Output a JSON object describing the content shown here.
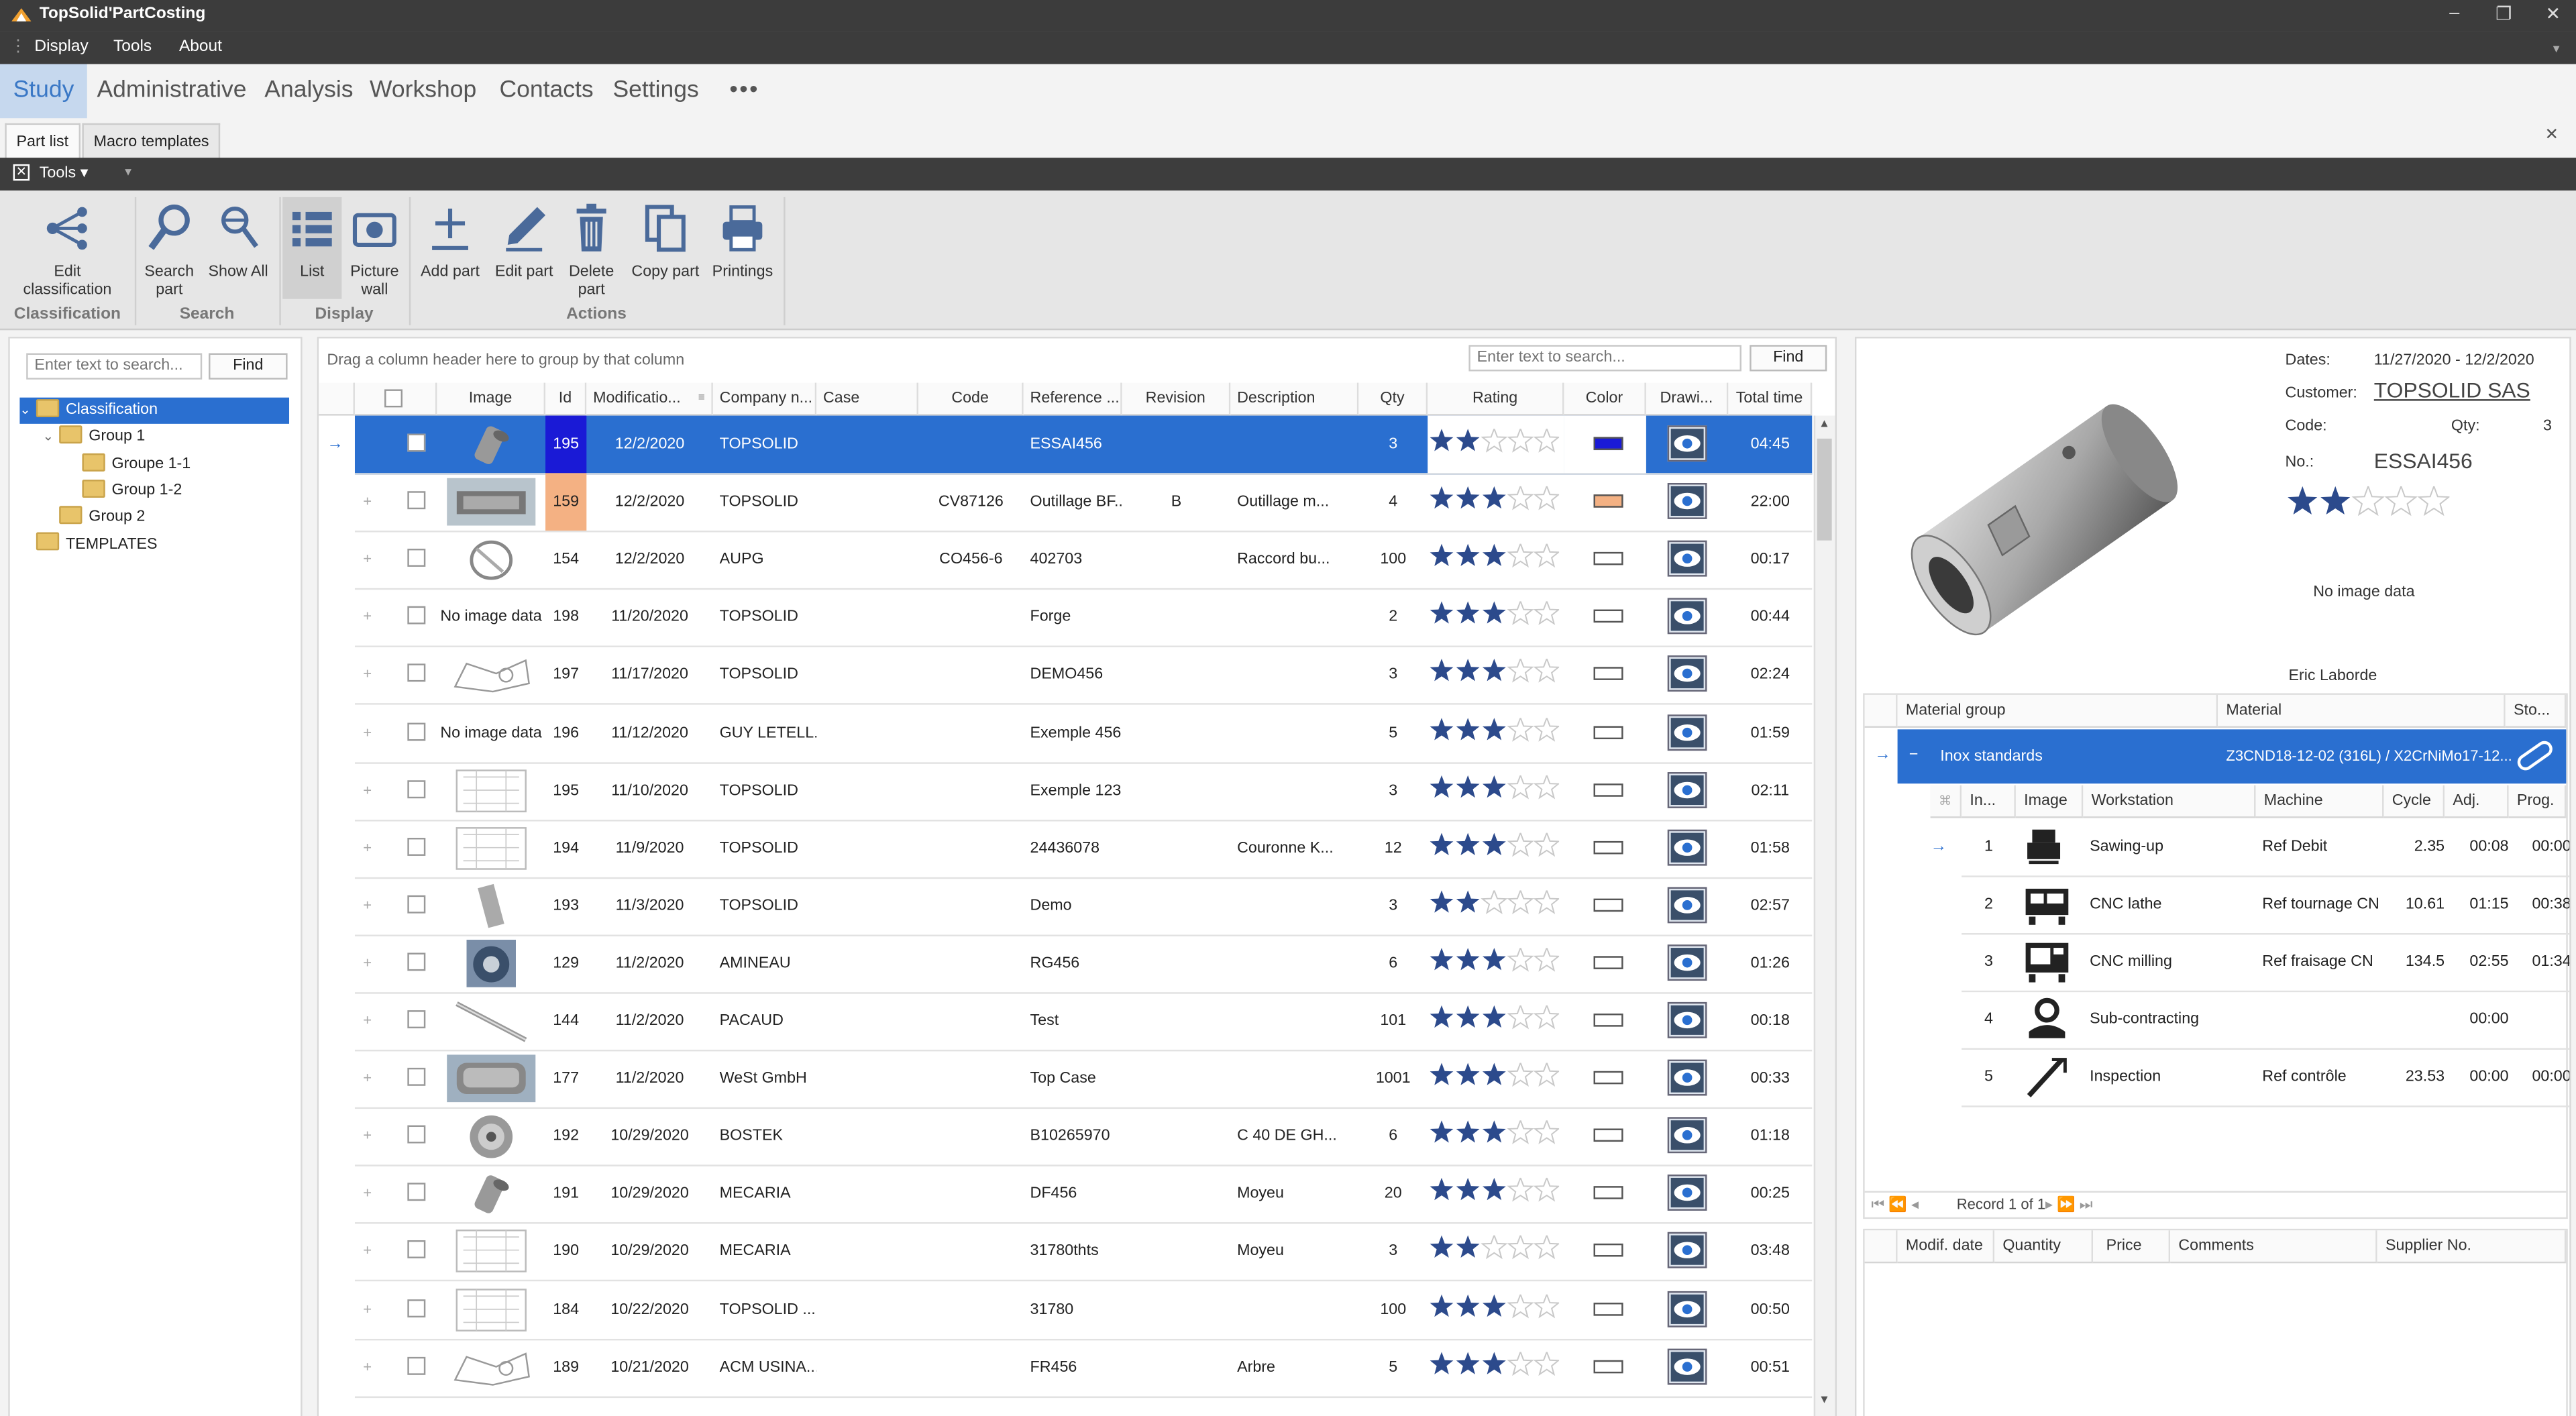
{
  "window": {
    "title": "TopSolid'PartCosting",
    "controls": [
      "–",
      "❐",
      "✕"
    ]
  },
  "menu": [
    "Display",
    "Tools",
    "About"
  ],
  "modules": [
    "Study",
    "Administrative",
    "Analysis",
    "Workshop",
    "Contacts",
    "Settings",
    "•••"
  ],
  "subtabs": [
    "Part list",
    "Macro templates"
  ],
  "tools_label": "Tools",
  "ribbon": {
    "buttons": [
      {
        "label": "Edit classification",
        "icon": "classification-icon"
      },
      {
        "label": "Search part",
        "icon": "search-icon"
      },
      {
        "label": "Show All",
        "icon": "show-all-icon"
      },
      {
        "label": "List",
        "icon": "list-icon"
      },
      {
        "label": "Picture wall",
        "icon": "picture-wall-icon"
      },
      {
        "label": "Add part",
        "icon": "add-icon"
      },
      {
        "label": "Edit part",
        "icon": "pencil-icon"
      },
      {
        "label": "Delete part",
        "icon": "trash-icon"
      },
      {
        "label": "Copy part",
        "icon": "copy-icon"
      },
      {
        "label": "Printings",
        "icon": "printer-icon"
      }
    ],
    "groups": [
      "Classification",
      "Search",
      "Display",
      "Actions"
    ]
  },
  "tree": {
    "search_placeholder": "Enter text to search...",
    "find_label": "Find",
    "items": [
      {
        "label": "Classification",
        "level": 0,
        "expanded": true,
        "selected": true
      },
      {
        "label": "Group 1",
        "level": 1,
        "expanded": true
      },
      {
        "label": "Groupe 1-1",
        "level": 2
      },
      {
        "label": "Group 1-2",
        "level": 2
      },
      {
        "label": "Group 2",
        "level": 1
      },
      {
        "label": "TEMPLATES",
        "level": 0
      }
    ]
  },
  "grid": {
    "group_hint": "Drag a column header here to group by that column",
    "search_placeholder": "Enter text to search...",
    "find_label": "Find",
    "columns": [
      "Image",
      "Id",
      "Modificatio...",
      "Company n...",
      "Case",
      "Code",
      "Reference ...",
      "Revision",
      "Description",
      "Qty",
      "Rating",
      "Color",
      "Drawi...",
      "Total time"
    ],
    "no_image_text": "No image data",
    "rows": [
      {
        "thumb": "cylinder",
        "id": "195",
        "date": "12/2/2020",
        "company": "TOPSOLID",
        "case": "",
        "code": "",
        "ref": "ESSAI456",
        "rev": "",
        "desc": "",
        "qty": "3",
        "rating": 2,
        "color": "#1a1ad6",
        "id_bg": "#1a1ad6",
        "time": "04:45",
        "selected": true
      },
      {
        "thumb": "block",
        "id": "159",
        "date": "12/2/2020",
        "company": "TOPSOLID",
        "case": "",
        "code": "CV87126",
        "ref": "Outillage BF...",
        "rev": "B",
        "desc": "Outillage m...",
        "qty": "4",
        "rating": 3,
        "color": "#f4b183",
        "id_bg": "#f4b183",
        "time": "22:00"
      },
      {
        "thumb": "fitting",
        "id": "154",
        "date": "12/2/2020",
        "company": "AUPG",
        "case": "",
        "code": "CO456-6",
        "ref": "402703",
        "rev": "",
        "desc": "Raccord bu...",
        "qty": "100",
        "rating": 3,
        "color": "#ffffff",
        "time": "00:17"
      },
      {
        "thumb": "none",
        "id": "198",
        "date": "11/20/2020",
        "company": "TOPSOLID",
        "case": "",
        "code": "",
        "ref": "Forge",
        "rev": "",
        "desc": "",
        "qty": "2",
        "rating": 3,
        "color": "#ffffff",
        "time": "00:44"
      },
      {
        "thumb": "sketch",
        "id": "197",
        "date": "11/17/2020",
        "company": "TOPSOLID",
        "case": "",
        "code": "",
        "ref": "DEMO456",
        "rev": "",
        "desc": "",
        "qty": "3",
        "rating": 3,
        "color": "#ffffff",
        "time": "02:24"
      },
      {
        "thumb": "none",
        "id": "196",
        "date": "11/12/2020",
        "company": "GUY LETELL...",
        "case": "",
        "code": "",
        "ref": "Exemple 456",
        "rev": "",
        "desc": "",
        "qty": "5",
        "rating": 3,
        "color": "#ffffff",
        "time": "01:59"
      },
      {
        "thumb": "drawing",
        "id": "195",
        "date": "11/10/2020",
        "company": "TOPSOLID",
        "case": "",
        "code": "",
        "ref": "Exemple 123",
        "rev": "",
        "desc": "",
        "qty": "3",
        "rating": 3,
        "color": "#ffffff",
        "time": "02:11"
      },
      {
        "thumb": "drawing",
        "id": "194",
        "date": "11/9/2020",
        "company": "TOPSOLID",
        "case": "",
        "code": "",
        "ref": "24436078",
        "rev": "",
        "desc": "Couronne K...",
        "qty": "12",
        "rating": 3,
        "color": "#ffffff",
        "time": "01:58"
      },
      {
        "thumb": "shaft",
        "id": "193",
        "date": "11/3/2020",
        "company": "TOPSOLID",
        "case": "",
        "code": "",
        "ref": "Demo",
        "rev": "",
        "desc": "",
        "qty": "3",
        "rating": 2,
        "color": "#ffffff",
        "time": "02:57"
      },
      {
        "thumb": "ring",
        "id": "129",
        "date": "11/2/2020",
        "company": "AMINEAU",
        "case": "",
        "code": "",
        "ref": "RG456",
        "rev": "",
        "desc": "",
        "qty": "6",
        "rating": 3,
        "color": "#ffffff",
        "time": "01:26"
      },
      {
        "thumb": "rod",
        "id": "144",
        "date": "11/2/2020",
        "company": "PACAUD",
        "case": "",
        "code": "",
        "ref": "Test",
        "rev": "",
        "desc": "",
        "qty": "101",
        "rating": 3,
        "color": "#ffffff",
        "time": "00:18"
      },
      {
        "thumb": "case",
        "id": "177",
        "date": "11/2/2020",
        "company": "WeSt GmbH",
        "case": "",
        "code": "",
        "ref": "Top Case",
        "rev": "",
        "desc": "",
        "qty": "1001",
        "rating": 3,
        "color": "#ffffff",
        "time": "00:33"
      },
      {
        "thumb": "gear",
        "id": "192",
        "date": "10/29/2020",
        "company": "BOSTEK",
        "case": "",
        "code": "",
        "ref": "B10265970",
        "rev": "",
        "desc": "C 40 DE GH...",
        "qty": "6",
        "rating": 3,
        "color": "#ffffff",
        "time": "01:18"
      },
      {
        "thumb": "cylinder",
        "id": "191",
        "date": "10/29/2020",
        "company": "MECARIA",
        "case": "",
        "code": "",
        "ref": "DF456",
        "rev": "",
        "desc": "Moyeu",
        "qty": "20",
        "rating": 3,
        "color": "#ffffff",
        "time": "00:25"
      },
      {
        "thumb": "drawing",
        "id": "190",
        "date": "10/29/2020",
        "company": "MECARIA",
        "case": "",
        "code": "",
        "ref": "31780thts",
        "rev": "",
        "desc": "Moyeu",
        "qty": "3",
        "rating": 2,
        "color": "#ffffff",
        "time": "03:48"
      },
      {
        "thumb": "drawing",
        "id": "184",
        "date": "10/22/2020",
        "company": "TOPSOLID ...",
        "case": "",
        "code": "",
        "ref": "31780",
        "rev": "",
        "desc": "",
        "qty": "100",
        "rating": 3,
        "color": "#ffffff",
        "time": "00:50"
      },
      {
        "thumb": "sketch",
        "id": "189",
        "date": "10/21/2020",
        "company": "ACM USINA...",
        "case": "",
        "code": "",
        "ref": "FR456",
        "rev": "",
        "desc": "Arbre",
        "qty": "5",
        "rating": 3,
        "color": "#ffffff",
        "time": "00:51"
      }
    ]
  },
  "detail": {
    "dates_label": "Dates:",
    "dates": "11/27/2020 - 12/2/2020",
    "customer_label": "Customer:",
    "customer": "TOPSOLID SAS",
    "code_label": "Code:",
    "qty_label": "Qty:",
    "qty": "3",
    "no_label": "No.:",
    "no": "ESSAI456",
    "rating": 2,
    "no_image": "No image data",
    "author": "Eric Laborde"
  },
  "materials": {
    "headers": [
      "Material group",
      "Material",
      "Sto..."
    ],
    "group": "Inox standards",
    "material": "Z3CND18-12-02 (316L) / X2CrNiMo17-12...",
    "op_headers": [
      "In...",
      "Image",
      "Workstation",
      "Machine",
      "Cycle",
      "Adj.",
      "Prog."
    ],
    "operations": [
      {
        "index": "1",
        "workstation": "Sawing-up",
        "machine": "Ref Debit",
        "cycle": "2.35",
        "adj": "00:08",
        "prog": "00:00",
        "icon": "saw-icon"
      },
      {
        "index": "2",
        "workstation": "CNC lathe",
        "machine": "Ref tournage CN",
        "cycle": "10.61",
        "adj": "01:15",
        "prog": "00:38",
        "icon": "lathe-icon"
      },
      {
        "index": "3",
        "workstation": "CNC milling",
        "machine": "Ref fraisage CN",
        "cycle": "134.5",
        "adj": "02:55",
        "prog": "01:34",
        "icon": "mill-icon"
      },
      {
        "index": "4",
        "workstation": "Sub-contracting",
        "machine": "",
        "cycle": "",
        "adj": "00:00",
        "prog": "",
        "icon": "subcontract-icon"
      },
      {
        "index": "5",
        "workstation": "Inspection",
        "machine": "Ref contrôle",
        "cycle": "23.53",
        "adj": "00:00",
        "prog": "00:00",
        "icon": "inspection-icon"
      }
    ],
    "record_nav": "Record 1 of 1"
  },
  "supplier": {
    "headers": [
      "Modif. date",
      "Quantity",
      "Price",
      "Comments",
      "Supplier No."
    ]
  },
  "colors": {
    "selection": "#2a6fd0",
    "accent": "#3a78c6",
    "tab_active_bg": "#c6d8ee",
    "star": "#2c4a8c"
  }
}
